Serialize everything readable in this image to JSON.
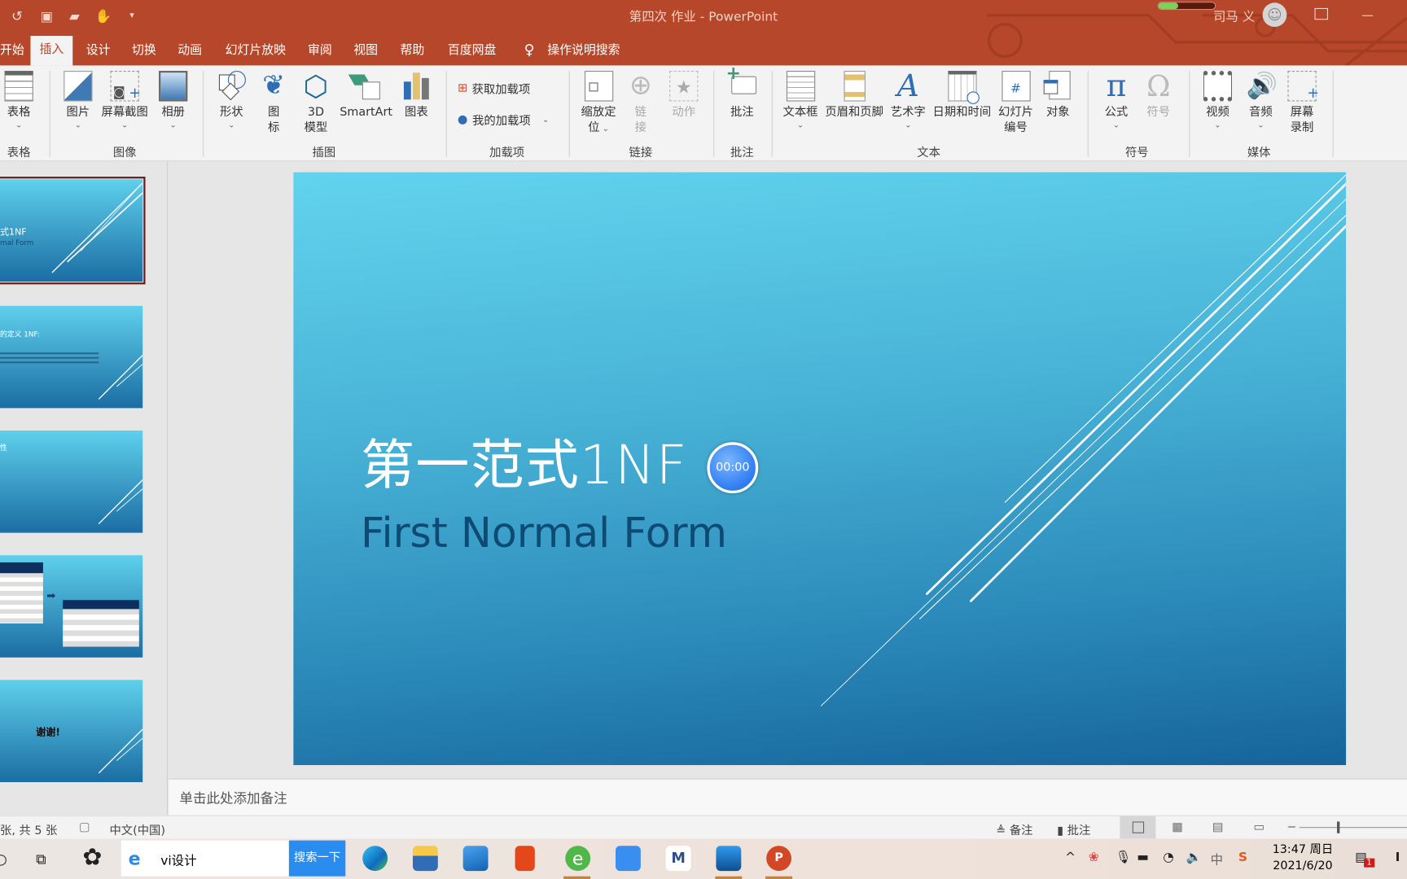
{
  "window": {
    "title": "第四次 作业  -  PowerPoint",
    "user": "司马 义"
  },
  "quick_access": [
    "undo-icon",
    "present-icon",
    "open-icon",
    "touch-mode-icon",
    "customize-icon"
  ],
  "tabs": [
    {
      "label": "开始"
    },
    {
      "label": "插入",
      "selected": true
    },
    {
      "label": "设计"
    },
    {
      "label": "切换"
    },
    {
      "label": "动画"
    },
    {
      "label": "幻灯片放映"
    },
    {
      "label": "审阅"
    },
    {
      "label": "视图"
    },
    {
      "label": "帮助"
    },
    {
      "label": "百度网盘"
    }
  ],
  "tell_me": "操作说明搜索",
  "ribbon": {
    "groups": [
      "表格",
      "图像",
      "插图",
      "加载项",
      "链接",
      "批注",
      "文本",
      "符号",
      "媒体"
    ],
    "buttons": {
      "table": "表格",
      "picture": "图片",
      "screenshot": "屏幕截图",
      "album": "相册",
      "shapes": "形状",
      "icons_1": "图",
      "icons_2": "标",
      "model_1": "3D",
      "model_2": "模型",
      "smartart": "SmartArt",
      "chart": "图表",
      "get_addins": "获取加载项",
      "my_addins": "我的加载项",
      "zoom_1": "缩放定",
      "zoom_2": "位",
      "link_1": "链",
      "link_2": "接",
      "action": "动作",
      "comment": "批注",
      "textbox": "文本框",
      "header_footer": "页眉和页脚",
      "wordart": "艺术字",
      "datetime": "日期和时间",
      "slide_num_1": "幻灯片",
      "slide_num_2": "编号",
      "object": "对象",
      "equation": "公式",
      "symbol": "符号",
      "video": "视频",
      "audio": "音频",
      "screen_rec_1": "屏幕",
      "screen_rec_2": "录制"
    }
  },
  "thumbnails": [
    {
      "title": "式1NF",
      "subtitle": "mal Form",
      "selected": true
    },
    {
      "title": "的定义 1NF:"
    },
    {
      "title": "性"
    },
    {
      "title": ""
    },
    {
      "title": "谢谢!"
    }
  ],
  "slide": {
    "title": "第一范式1NF",
    "subtitle": "First Normal Form",
    "timer": "00:00",
    "colors": {
      "top": "#62d3ee",
      "bottom": "#15649a",
      "subtitle": "#0d4b74"
    }
  },
  "notes": {
    "placeholder": "单击此处添加备注"
  },
  "status": {
    "slide_count": "张, 共 5 张",
    "language": "中文(中国)",
    "notes": "备注",
    "comments": "批注"
  },
  "taskbar": {
    "search_value": "vi设计",
    "search_button": "搜索一下",
    "apps": [
      "edge-icon",
      "file-explorer-icon",
      "mail-icon",
      "office-icon",
      "browser-icon",
      "cloud-icon",
      "m-app-icon",
      "photos-icon",
      "powerpoint-icon"
    ],
    "time": "13:47 周日",
    "date": "2021/6/20",
    "notification_count": "1"
  }
}
